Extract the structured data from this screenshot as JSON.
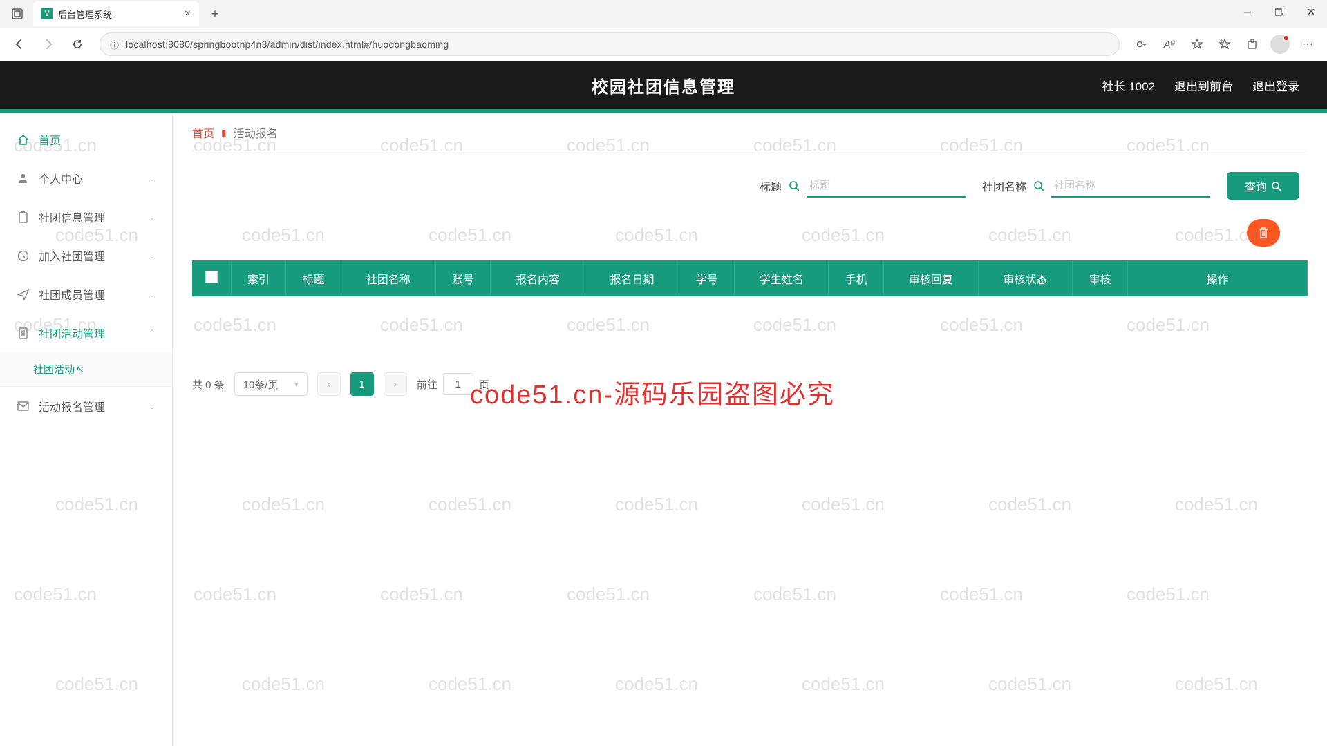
{
  "browser": {
    "tab_title": "后台管理系统",
    "url": "localhost:8080/springbootnp4n3/admin/dist/index.html#/huodongbaoming"
  },
  "header": {
    "title": "校园社团信息管理",
    "user": "社长 1002",
    "front_link": "退出到前台",
    "logout": "退出登录"
  },
  "sidebar": {
    "home": "首页",
    "items": [
      {
        "label": "个人中心",
        "expanded": false
      },
      {
        "label": "社团信息管理",
        "expanded": false
      },
      {
        "label": "加入社团管理",
        "expanded": false
      },
      {
        "label": "社团成员管理",
        "expanded": false
      },
      {
        "label": "社团活动管理",
        "expanded": true
      },
      {
        "label": "活动报名管理",
        "expanded": false
      }
    ],
    "submenu_activity": "社团活动"
  },
  "breadcrumb": {
    "home": "首页",
    "page": "活动报名"
  },
  "filters": {
    "title_label": "标题",
    "title_placeholder": "标题",
    "club_label": "社团名称",
    "club_placeholder": "社团名称",
    "search_btn": "查询"
  },
  "table": {
    "headers": [
      "索引",
      "标题",
      "社团名称",
      "账号",
      "报名内容",
      "报名日期",
      "学号",
      "学生姓名",
      "手机",
      "审核回复",
      "审核状态",
      "审核",
      "操作"
    ]
  },
  "pagination": {
    "total": "共 0 条",
    "page_size": "10条/页",
    "current": "1",
    "goto_prefix": "前往",
    "goto_value": "1",
    "goto_suffix": "页"
  },
  "watermark": {
    "small": "code51.cn",
    "big": "code51.cn-源码乐园盗图必究"
  }
}
